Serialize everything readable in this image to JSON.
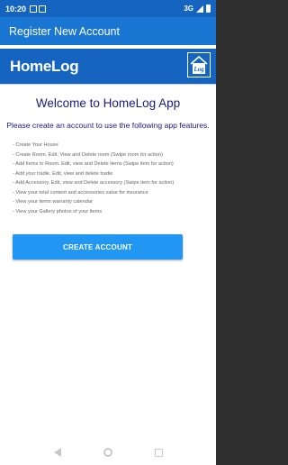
{
  "status_bar": {
    "time": "10:20",
    "network": "3G"
  },
  "app_bar": {
    "title": "Register New Account"
  },
  "brand": {
    "name": "HomeLog",
    "logo_text": "Log"
  },
  "main": {
    "welcome": "Welcome to HomeLog App",
    "intro": "Please create an account to use the following app features.",
    "features": [
      "- Create Your House",
      "- Create Room. Edit, View and Delete room (Swipe room for action)",
      "- Add Items to Room. Edit, view and Delete items (Swipe item for action)",
      "- Add your tradie. Edit, view and delete tradie",
      "- Add Accessory. Edit, view and Delete accessory (Swipe item for action)",
      "- View your total content and accessories value for insurance",
      "- View your items warranty calendar",
      "- View your Gallery photos of your items"
    ],
    "create_button": "CREATE ACCOUNT"
  },
  "colors": {
    "status_bar": "#1565c0",
    "app_bar": "#1976d2",
    "brand_bar": "#1565c0",
    "heading_text": "#1a1a80",
    "button": "#2196f3"
  },
  "icons": {
    "logo": "house-logo-icon",
    "nav_back": "back-triangle-icon",
    "nav_home": "home-circle-icon",
    "nav_recent": "recent-square-icon"
  }
}
